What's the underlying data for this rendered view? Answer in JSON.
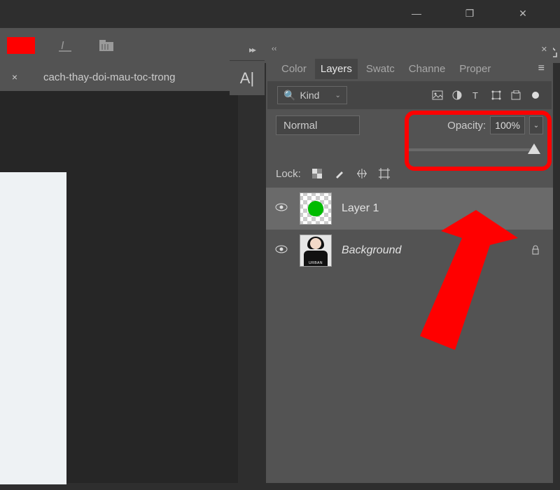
{
  "window": {
    "minimize": "—",
    "restore": "❐",
    "close": "✕"
  },
  "topbar": {
    "swatch_color": "#ff0000"
  },
  "doc_tab": {
    "close": "×",
    "name": "cach-thay-doi-mau-toc-trong"
  },
  "side_label": "A|",
  "collapse": "▸▸",
  "panel": {
    "head_left": "‹‹",
    "head_close": "✕",
    "tabs": {
      "color": "Color",
      "layers": "Layers",
      "swatches": "Swatc",
      "channels": "Channe",
      "properties": "Proper"
    },
    "menu": "≡"
  },
  "filter": {
    "search": "🔍",
    "kind": "Kind",
    "chev": "⌄"
  },
  "blend": {
    "mode": "Normal",
    "opacity_label": "Opacity:",
    "opacity_value": "100%",
    "chev": "⌄"
  },
  "lock": {
    "label": "Lock:"
  },
  "layers": [
    {
      "name": "Layer 1",
      "italic": false,
      "locked": false
    },
    {
      "name": "Background",
      "italic": true,
      "locked": true
    }
  ],
  "icons": {
    "eye": "👁",
    "lock": "🔒"
  }
}
